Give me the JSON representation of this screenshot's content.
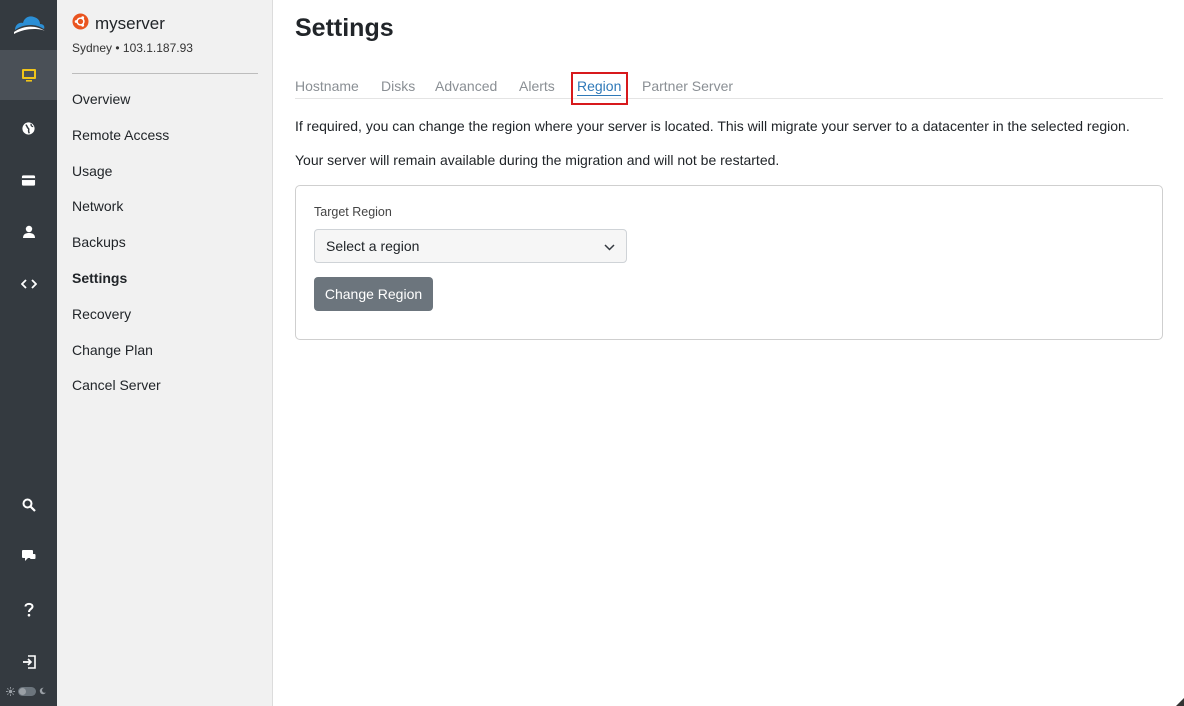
{
  "rail": {
    "items": [
      {
        "icon": "monitor-icon",
        "active": true
      },
      {
        "icon": "globe-icon"
      },
      {
        "icon": "credit-card-icon"
      },
      {
        "icon": "user-icon"
      },
      {
        "icon": "code-icon"
      },
      {
        "icon": "search-icon"
      },
      {
        "icon": "chat-icon"
      },
      {
        "icon": "help-icon"
      },
      {
        "icon": "logout-icon"
      }
    ]
  },
  "server": {
    "name": "myserver",
    "subtitle": "Sydney • 103.1.187.93",
    "os_icon": "ubuntu-icon"
  },
  "sidebar": {
    "items": [
      {
        "label": "Overview"
      },
      {
        "label": "Remote Access"
      },
      {
        "label": "Usage"
      },
      {
        "label": "Network"
      },
      {
        "label": "Backups"
      },
      {
        "label": "Settings",
        "active": true
      },
      {
        "label": "Recovery"
      },
      {
        "label": "Change Plan"
      },
      {
        "label": "Cancel Server"
      }
    ]
  },
  "main": {
    "title": "Settings",
    "tabs": [
      {
        "label": "Hostname"
      },
      {
        "label": "Disks"
      },
      {
        "label": "Advanced"
      },
      {
        "label": "Alerts"
      },
      {
        "label": "Region",
        "active": true
      },
      {
        "label": "Partner Server"
      }
    ],
    "description_1": "If required, you can change the region where your server is located. This will migrate your server to a datacenter in the selected region.",
    "description_2": "Your server will remain available during the migration and will not be restarted.",
    "form": {
      "label": "Target Region",
      "select_value": "Select a region",
      "button_label": "Change Region"
    }
  },
  "colors": {
    "rail_bg": "#343a40",
    "accent": "#2f79b8",
    "highlight": "#d7191c",
    "button": "#6c757d",
    "ubuntu": "#e95420",
    "monitor_active": "#f0c419"
  }
}
